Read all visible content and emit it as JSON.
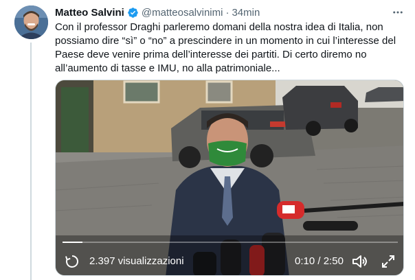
{
  "tweet": {
    "author": {
      "display_name": "Matteo Salvini",
      "handle": "@matteosalvinimi",
      "verified": true,
      "avatar_icon": "profile-photo"
    },
    "separator": "·",
    "timestamp": "34min",
    "text": "Con il professor Draghi parleremo domani della nostra idea di Italia, non possiamo dire “sì” o “no” a prescindere in un momento in cui l’interesse del Paese deve venire prima dell’interesse dei partiti. Di certo diremo no all’aumento di tasse e IMU, no alla patrimoniale...",
    "more_icon": "more-dots-icon"
  },
  "video": {
    "views": "2.397 visualizzazioni",
    "current_time": "0:10",
    "time_separator": " / ",
    "duration": "2:50",
    "progress": 0.06,
    "icons": {
      "replay": "replay-icon",
      "volume": "volume-muted-icon",
      "fullscreen": "fullscreen-icon"
    }
  },
  "colors": {
    "verified_blue": "#1d9bf0",
    "secondary_text": "#536471",
    "primary_text": "#0f1419"
  }
}
